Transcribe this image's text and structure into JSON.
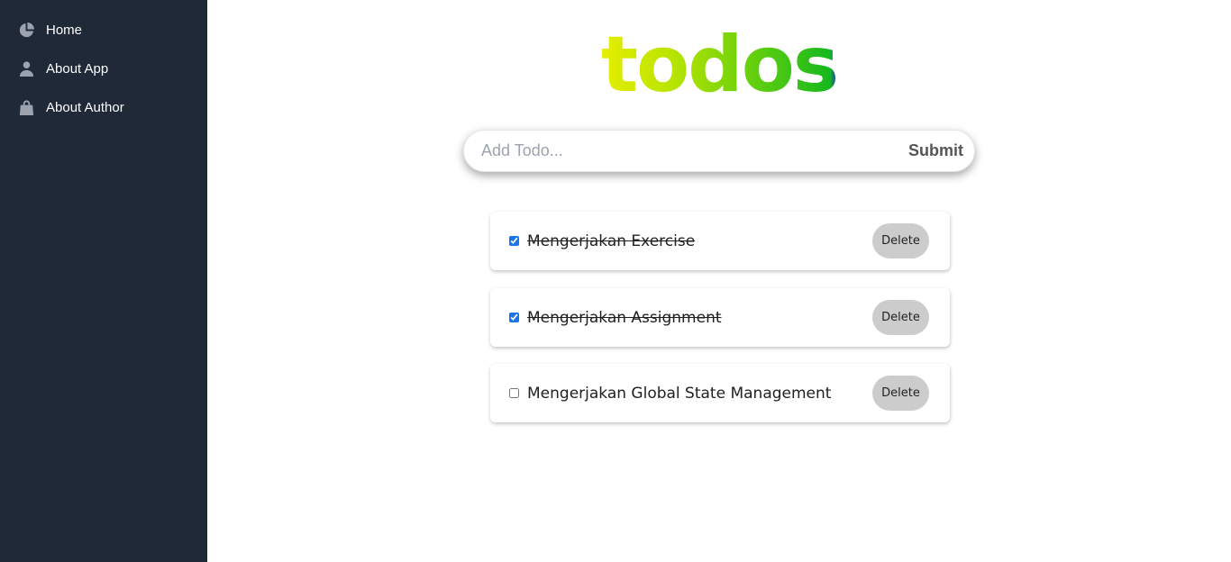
{
  "sidebar": {
    "items": [
      {
        "label": "Home",
        "icon": "pie-chart-icon"
      },
      {
        "label": "About App",
        "icon": "user-icon"
      },
      {
        "label": "About Author",
        "icon": "bag-icon"
      }
    ]
  },
  "app": {
    "title": "todos",
    "input_placeholder": "Add Todo...",
    "input_value": "",
    "submit_label": "Submit",
    "title_gradient": [
      "#e6ee00",
      "#b9e400",
      "#62cf0e",
      "#16b81e",
      "#1330d0"
    ]
  },
  "todos": [
    {
      "text": "Mengerjakan Exercise",
      "completed": true,
      "delete_label": "Delete"
    },
    {
      "text": "Mengerjakan Assignment",
      "completed": true,
      "delete_label": "Delete"
    },
    {
      "text": "Mengerjakan Global State Management",
      "completed": false,
      "delete_label": "Delete"
    }
  ],
  "colors": {
    "sidebar_bg": "#1f2937",
    "icon": "#9ca3af",
    "delete_bg": "#cccccc",
    "checkbox_accent": "#1a73e8"
  }
}
